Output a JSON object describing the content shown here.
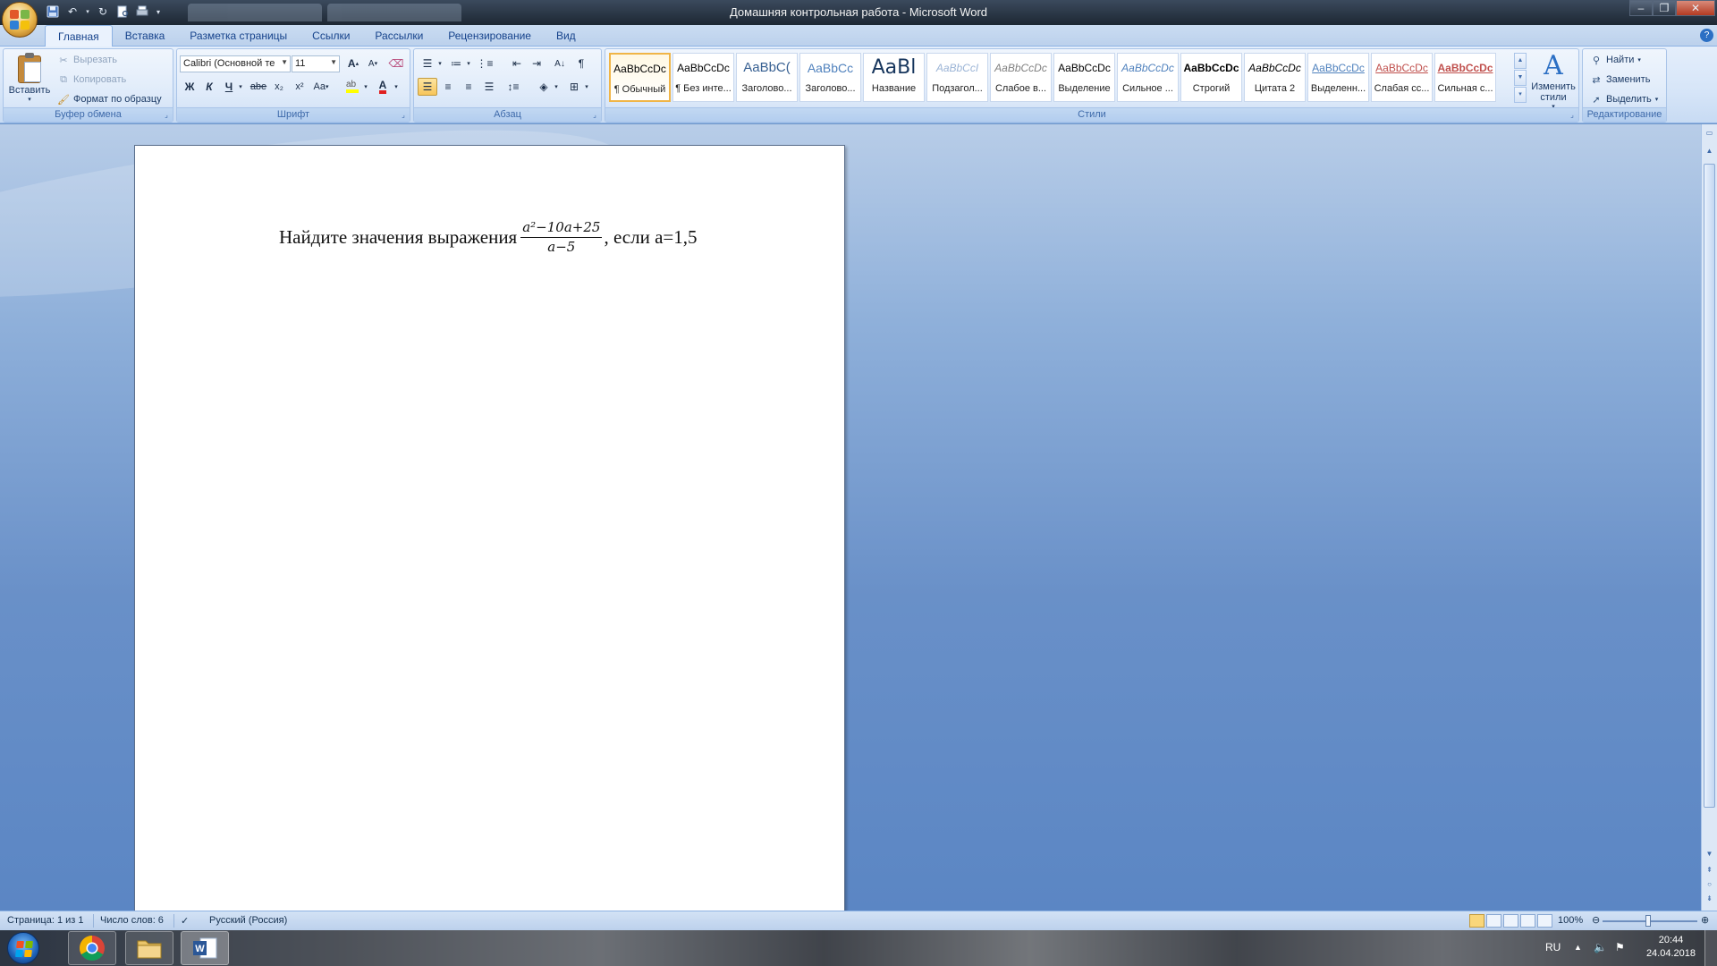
{
  "window": {
    "title": "Домашняя контрольная работа - Microsoft Word"
  },
  "ribbon_tabs": [
    "Главная",
    "Вставка",
    "Разметка страницы",
    "Ссылки",
    "Рассылки",
    "Рецензирование",
    "Вид"
  ],
  "clipboard": {
    "paste_label": "Вставить",
    "cut_label": "Вырезать",
    "copy_label": "Копировать",
    "format_painter_label": "Формат по образцу",
    "group_label": "Буфер обмена"
  },
  "font": {
    "font_name": "Calibri (Основной те",
    "font_size": "11",
    "bold": "Ж",
    "italic": "К",
    "underline": "Ч",
    "strikethrough": "abe",
    "subscript": "x₂",
    "superscript": "x²",
    "change_case": "Aa",
    "grow": "A",
    "shrink": "A",
    "font_color_letter": "A",
    "group_label": "Шрифт"
  },
  "paragraph": {
    "group_label": "Абзац",
    "pilcrow": "¶"
  },
  "styles": {
    "gallery": [
      {
        "sample": "AaBbCcDc",
        "name": "¶ Обычный",
        "color": "#000000",
        "active": true
      },
      {
        "sample": "AaBbCcDc",
        "name": "¶ Без инте...",
        "color": "#000000"
      },
      {
        "sample": "AaBbC(",
        "name": "Заголово...",
        "color": "#365f91"
      },
      {
        "sample": "AaBbCc",
        "name": "Заголово...",
        "color": "#4f81bd"
      },
      {
        "sample": "AaBl",
        "name": "Название",
        "color": "#17365d"
      },
      {
        "sample": "AaBbCcI",
        "name": "Подзагол...",
        "color": "#9bb4d6"
      },
      {
        "sample": "AaBbCcDc",
        "name": "Слабое в...",
        "color": "#808080"
      },
      {
        "sample": "AaBbCcDc",
        "name": "Выделение",
        "color": "#000000"
      },
      {
        "sample": "AaBbCcDc",
        "name": "Сильное ...",
        "color": "#4f81bd"
      },
      {
        "sample": "AaBbCcDc",
        "name": "Строгий",
        "color": "#000000"
      },
      {
        "sample": "AaBbCcDc",
        "name": "Цитата 2",
        "color": "#000000"
      },
      {
        "sample": "AaBbCcDc",
        "name": "Выделенн...",
        "color": "#4f81bd"
      },
      {
        "sample": "AaBbCcDc",
        "name": "Слабая сс...",
        "color": "#c0504d"
      },
      {
        "sample": "AaBbCcDc",
        "name": "Сильная с...",
        "color": "#c0504d"
      }
    ],
    "change_styles_label": "Изменить стили",
    "group_label": "Стили"
  },
  "editing": {
    "find_label": "Найти",
    "replace_label": "Заменить",
    "select_label": "Выделить",
    "group_label": "Редактирование"
  },
  "document": {
    "text_before": "Найдите значения выражения ",
    "numerator": "a²−10a+25",
    "denominator": "a−5",
    "text_after": ", если а=1,5"
  },
  "statusbar": {
    "page": "Страница: 1 из 1",
    "words": "Число слов: 6",
    "language": "Русский (Россия)",
    "zoom": "100%"
  },
  "taskbar": {
    "lang": "RU",
    "time": "20:44",
    "date": "24.04.2018"
  }
}
